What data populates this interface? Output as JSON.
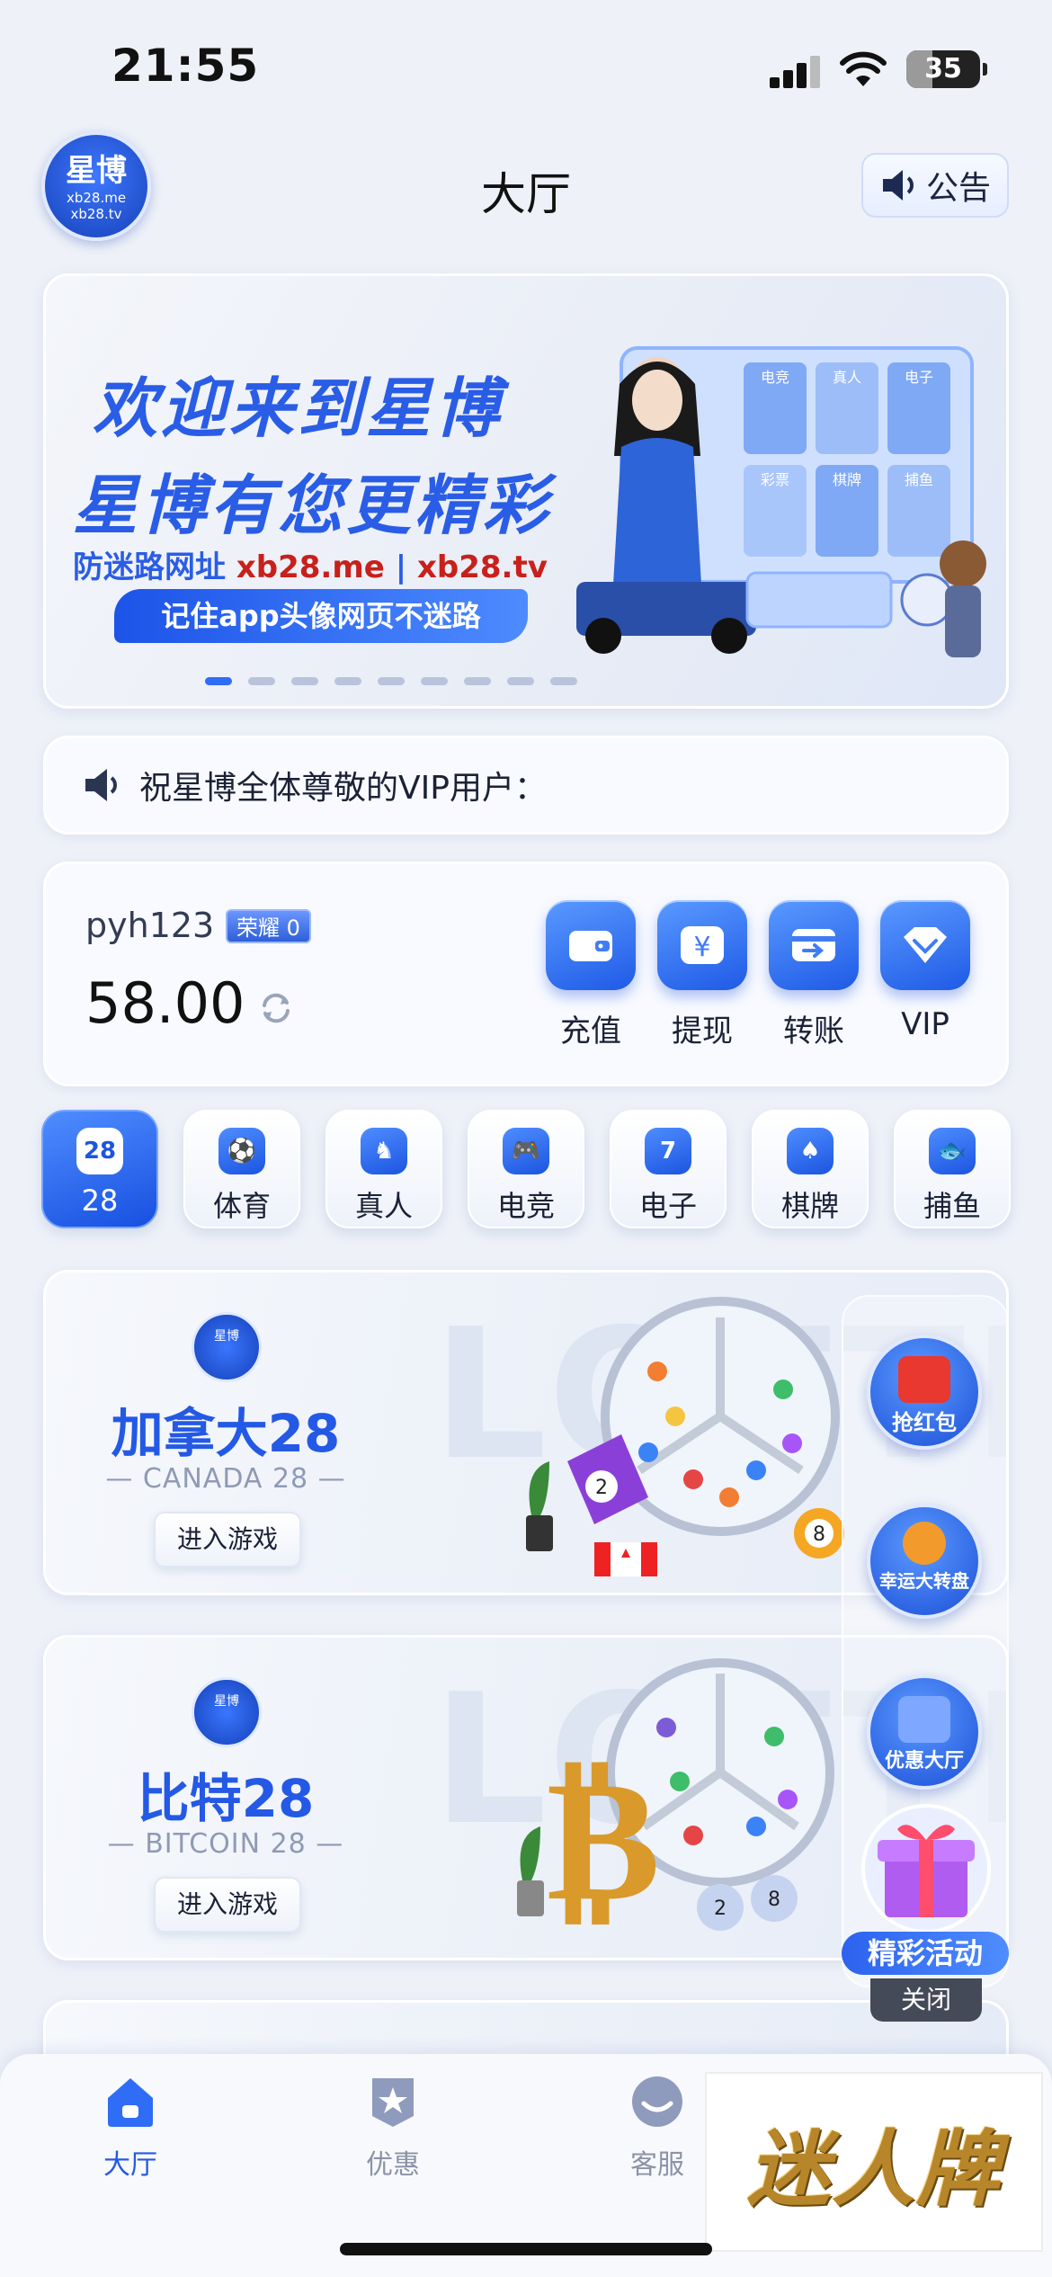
{
  "status_bar": {
    "time": "21:55",
    "battery": "35",
    "battery_level": 0.35
  },
  "header": {
    "logo_text": "星博",
    "logo_sub1": "xb28.me",
    "logo_sub2": "xb28.tv",
    "title": "大厅",
    "notice_label": "公告"
  },
  "banner": {
    "line1": "欢迎来到星博",
    "line2": "星博有您更精彩",
    "line3_prefix": "防迷路网址",
    "line3_url1": "xb28.me",
    "line3_sep": "|",
    "line3_url2": "xb28.tv",
    "pill": "记住app头像网页不迷路",
    "tiles": [
      "电竞",
      "真人",
      "电子",
      "彩票",
      "棋牌",
      "捕鱼"
    ],
    "dots_total": 9,
    "dots_active": 0
  },
  "marquee": {
    "text": "祝星博全体尊敬的VIP用户："
  },
  "wallet": {
    "username": "pyh123",
    "badge": "荣耀 0",
    "balance": "58.00",
    "actions": [
      {
        "label": "充值",
        "icon": "wallet-icon"
      },
      {
        "label": "提现",
        "icon": "yen-icon"
      },
      {
        "label": "转账",
        "icon": "transfer-card-icon"
      },
      {
        "label": "VIP",
        "icon": "diamond-icon"
      }
    ]
  },
  "categories": [
    {
      "label": "28",
      "icon_text": "28",
      "active": true
    },
    {
      "label": "体育",
      "icon_text": "⚽",
      "active": false
    },
    {
      "label": "真人",
      "icon_text": "♞",
      "active": false
    },
    {
      "label": "电竞",
      "icon_text": "🎮",
      "active": false
    },
    {
      "label": "电子",
      "icon_text": "7",
      "active": false
    },
    {
      "label": "棋牌",
      "icon_text": "♠",
      "active": false
    },
    {
      "label": "捕鱼",
      "icon_text": "🐟",
      "active": false
    }
  ],
  "games": [
    {
      "watermark": "LOTTERY",
      "logo": "星博",
      "title": "加拿大28",
      "subtitle": "— CANADA 28 —",
      "button": "进入游戏"
    },
    {
      "watermark": "LOTTERY",
      "logo": "星博",
      "title": "比特28",
      "subtitle": "— BITCOIN 28 —",
      "button": "进入游戏"
    }
  ],
  "floating": {
    "items": [
      "抢红包",
      "幸运大转盘",
      "优惠大厅"
    ],
    "promo": "精彩活动",
    "close": "关闭"
  },
  "tabbar": {
    "tabs": [
      {
        "label": "大厅",
        "icon": "home-icon",
        "active": true
      },
      {
        "label": "优惠",
        "icon": "star-icon",
        "active": false
      },
      {
        "label": "客服",
        "icon": "support-icon",
        "active": false
      }
    ],
    "brand_badge": "迷人牌"
  },
  "colors": {
    "accent": "#2459e6",
    "background": "#eef1f8",
    "red": "#c8201b"
  }
}
